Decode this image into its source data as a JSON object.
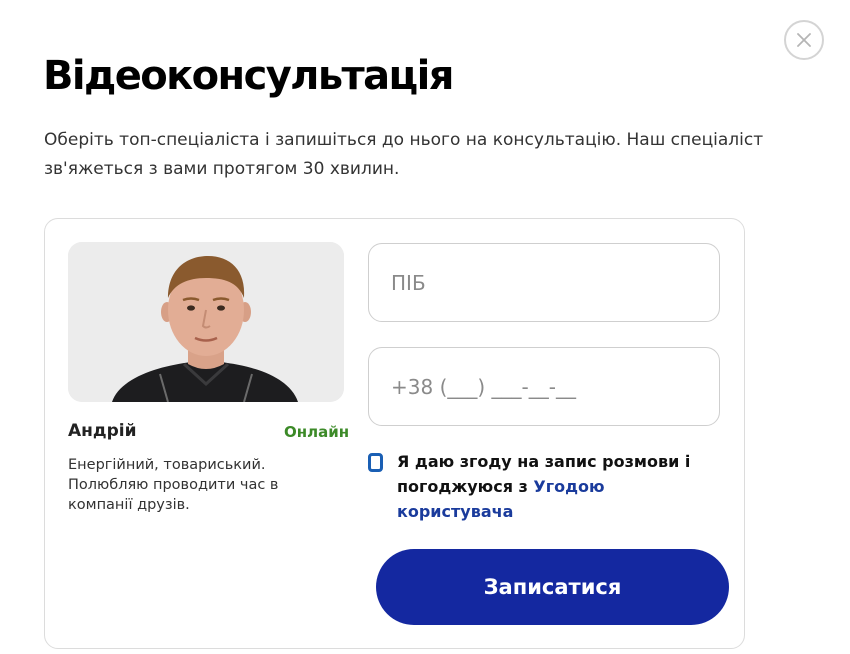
{
  "modal": {
    "title": "Відеоконсультація",
    "subtitle": "Оберіть топ-спеціаліста і запишіться до нього на консультацію. Наш спеціаліст зв'яжеться з вами протягом 30 хвилин.",
    "close_icon": "close-icon"
  },
  "specialist": {
    "name": "Андрій",
    "status": "Онлайн",
    "bio": "Енергійний, товариський. Полюбляю проводити час в компанії друзів.",
    "photo": "specialist-photo"
  },
  "form": {
    "name_placeholder": "ПІБ",
    "phone_placeholder": "+38 (___) ___-__-__",
    "consent_text": "Я даю згоду на запис розмови і погоджуюся з ",
    "consent_link": "Угодою користувача",
    "consent_checked": false,
    "submit_label": "Записатися"
  },
  "colors": {
    "primary_button": "#1428a0",
    "link": "#1a3b9c",
    "status_online": "#3c8a28",
    "checkbox_border": "#1a5fb4"
  }
}
